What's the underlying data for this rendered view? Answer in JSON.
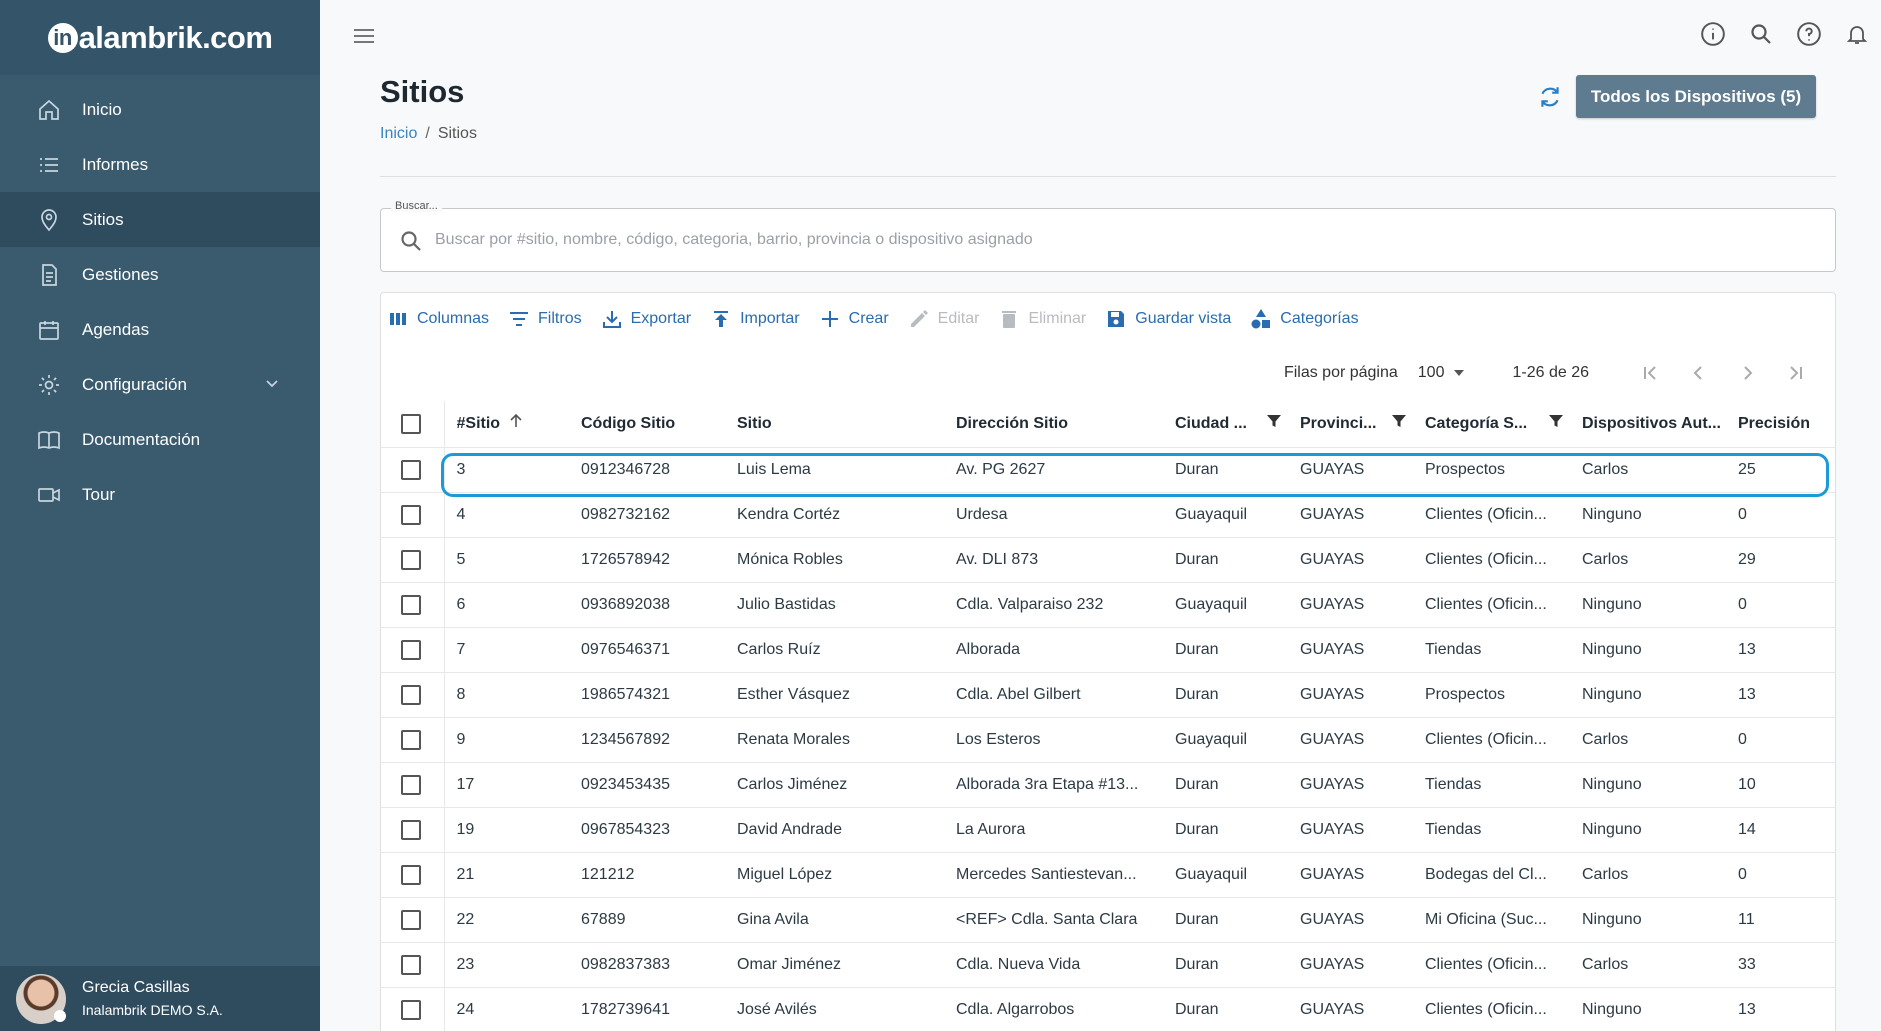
{
  "app": {
    "logo_prefix": "in",
    "logo_rest": "alambrik.com"
  },
  "sidebar": {
    "items": [
      {
        "label": "Inicio",
        "icon": "home-icon"
      },
      {
        "label": "Informes",
        "icon": "list-icon"
      },
      {
        "label": "Sitios",
        "icon": "location-pin-icon"
      },
      {
        "label": "Gestiones",
        "icon": "document-icon"
      },
      {
        "label": "Agendas",
        "icon": "calendar-icon"
      },
      {
        "label": "Configuración",
        "icon": "gear-icon"
      },
      {
        "label": "Documentación",
        "icon": "book-icon"
      },
      {
        "label": "Tour",
        "icon": "video-camera-icon"
      }
    ],
    "active": "Sitios"
  },
  "user": {
    "name": "Grecia Casillas",
    "company": "Inalambrik DEMO S.A."
  },
  "page": {
    "title": "Sitios",
    "breadcrumb_home": "Inicio",
    "breadcrumb_sep": "/",
    "breadcrumb_current": "Sitios"
  },
  "header": {
    "devices_button": "Todos los Dispositivos (5)"
  },
  "search": {
    "legend": "Buscar...",
    "placeholder": "Buscar por #sitio, nombre, código, categoria, barrio, provincia o dispositivo asignado"
  },
  "toolbar": {
    "columns": "Columnas",
    "filters": "Filtros",
    "export": "Exportar",
    "import": "Importar",
    "create": "Crear",
    "edit": "Editar",
    "delete": "Eliminar",
    "save_view": "Guardar vista",
    "categories": "Categorías"
  },
  "pager": {
    "rows_label": "Filas por página",
    "rows_value": "100",
    "range": "1-26 de 26"
  },
  "table": {
    "columns": [
      "#Sitio",
      "Código Sitio",
      "Sitio",
      "Dirección Sitio",
      "Ciudad ...",
      "Provinci...",
      "Categoría S...",
      "Dispositivos Aut...",
      "Precisión"
    ],
    "rows": [
      [
        "3",
        "0912346728",
        "Luis Lema",
        "Av. PG 2627",
        "Duran",
        "GUAYAS",
        "Prospectos",
        "Carlos",
        "25"
      ],
      [
        "4",
        "0982732162",
        "Kendra Cortéz",
        "Urdesa",
        "Guayaquil",
        "GUAYAS",
        "Clientes (Oficin...",
        "Ninguno",
        "0"
      ],
      [
        "5",
        "1726578942",
        "Mónica Robles",
        "Av. DLI 873",
        "Duran",
        "GUAYAS",
        "Clientes (Oficin...",
        "Carlos",
        "29"
      ],
      [
        "6",
        "0936892038",
        "Julio Bastidas",
        "Cdla. Valparaiso 232",
        "Guayaquil",
        "GUAYAS",
        "Clientes (Oficin...",
        "Ninguno",
        "0"
      ],
      [
        "7",
        "0976546371",
        "Carlos Ruíz",
        "Alborada",
        "Duran",
        "GUAYAS",
        "Tiendas",
        "Ninguno",
        "13"
      ],
      [
        "8",
        "1986574321",
        "Esther Vásquez",
        "Cdla. Abel Gilbert",
        "Duran",
        "GUAYAS",
        "Prospectos",
        "Ninguno",
        "13"
      ],
      [
        "9",
        "1234567892",
        "Renata Morales",
        "Los Esteros",
        "Guayaquil",
        "GUAYAS",
        "Clientes (Oficin...",
        "Carlos",
        "0"
      ],
      [
        "17",
        "0923453435",
        "Carlos Jiménez",
        "Alborada 3ra Etapa #13...",
        "Duran",
        "GUAYAS",
        "Tiendas",
        "Ninguno",
        "10"
      ],
      [
        "19",
        "0967854323",
        "David Andrade",
        "La Aurora",
        "Duran",
        "GUAYAS",
        "Tiendas",
        "Ninguno",
        "14"
      ],
      [
        "21",
        "121212",
        "Miguel López",
        "Mercedes Santiestevan...",
        "Guayaquil",
        "GUAYAS",
        "Bodegas del Cl...",
        "Carlos",
        "0"
      ],
      [
        "22",
        "67889",
        "Gina Avila",
        "<REF> Cdla. Santa Clara",
        "Duran",
        "GUAYAS",
        "Mi Oficina (Suc...",
        "Ninguno",
        "11"
      ],
      [
        "23",
        "0982837383",
        "Omar Jiménez",
        "Cdla. Nueva Vida",
        "Duran",
        "GUAYAS",
        "Clientes (Oficin...",
        "Carlos",
        "33"
      ],
      [
        "24",
        "1782739641",
        "José Avilés",
        "Cdla. Algarrobos",
        "Duran",
        "GUAYAS",
        "Clientes (Oficin...",
        "Ninguno",
        "13"
      ]
    ]
  },
  "colors": {
    "sidebar": "#3a5a6e",
    "accent": "#2a6cb0",
    "highlight": "#1a9bd7",
    "button": "#5e7b8f"
  }
}
